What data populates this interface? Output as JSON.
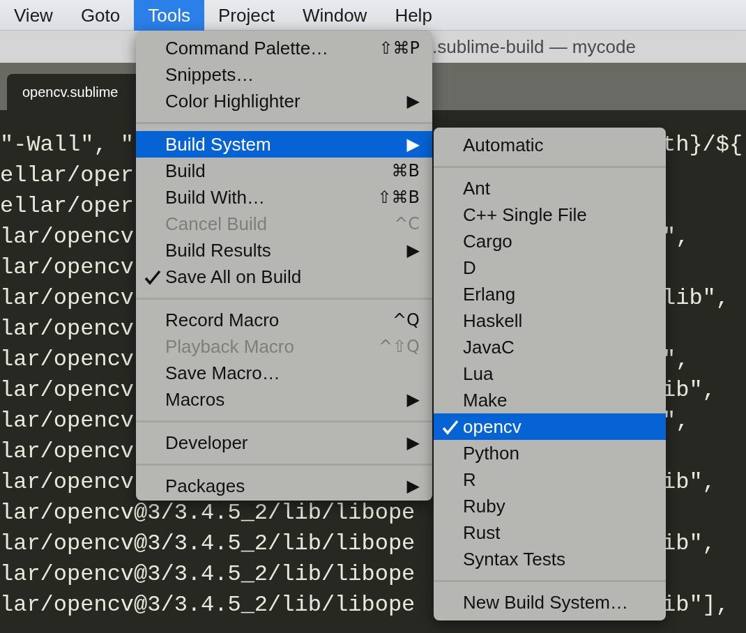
{
  "menu_bar": [
    {
      "label": "View",
      "selected": false
    },
    {
      "label": "Goto",
      "selected": false
    },
    {
      "label": "Tools",
      "selected": true
    },
    {
      "label": "Project",
      "selected": false
    },
    {
      "label": "Window",
      "selected": false
    },
    {
      "label": "Help",
      "selected": false
    }
  ],
  "window": {
    "title": ".sublime-build — mycode"
  },
  "tab": {
    "label": "opencv.sublime"
  },
  "editor_lines": [
    {
      "left": "\"-Wall\", \"",
      "right": "th}/${"
    },
    {
      "left": "ellar/oper"
    },
    {
      "left": "ellar/oper"
    },
    {
      "left": "lar/opencv",
      "right": "\","
    },
    {
      "left": "lar/opencv"
    },
    {
      "left": "lar/opencv",
      "right": "lib\","
    },
    {
      "left": "lar/opencv"
    },
    {
      "left": "lar/opencv",
      "right": "\","
    },
    {
      "left": "lar/opencv",
      "right": "ib\","
    },
    {
      "left": "lar/opencv",
      "right": "\","
    },
    {
      "left": "lar/opencv"
    },
    {
      "left": "lar/opencv",
      "right": "ib\","
    },
    {
      "left": "lar/opencv@3/3.4.5_2/lib/libope"
    },
    {
      "left": "lar/opencv@3/3.4.5_2/lib/libope",
      "right": "ib\","
    },
    {
      "left": "lar/opencv@3/3.4.5_2/lib/libope"
    },
    {
      "left": "lar/opencv@3/3.4.5_2/lib/libope",
      "right": "ib\"],"
    }
  ],
  "tools_menu": [
    {
      "kind": "item",
      "label": "Command Palette…",
      "shortcut": "⇧⌘P",
      "selected": false,
      "checked": false,
      "disabled": false
    },
    {
      "kind": "item",
      "label": "Snippets…",
      "selected": false,
      "checked": false,
      "disabled": false
    },
    {
      "kind": "item",
      "label": "Color Highlighter",
      "shortcut": "▶",
      "selected": false,
      "checked": false,
      "disabled": false
    },
    {
      "kind": "separator"
    },
    {
      "kind": "item",
      "label": "Build System",
      "shortcut": "▶",
      "selected": true,
      "checked": false,
      "disabled": false
    },
    {
      "kind": "item",
      "label": "Build",
      "shortcut": "⌘B",
      "selected": false,
      "checked": false,
      "disabled": false
    },
    {
      "kind": "item",
      "label": "Build With…",
      "shortcut": "⇧⌘B",
      "selected": false,
      "checked": false,
      "disabled": false
    },
    {
      "kind": "item",
      "label": "Cancel Build",
      "shortcut": "^C",
      "selected": false,
      "checked": false,
      "disabled": true
    },
    {
      "kind": "item",
      "label": "Build Results",
      "shortcut": "▶",
      "selected": false,
      "checked": false,
      "disabled": false
    },
    {
      "kind": "item",
      "label": "Save All on Build",
      "selected": false,
      "checked": true,
      "disabled": false
    },
    {
      "kind": "separator"
    },
    {
      "kind": "item",
      "label": "Record Macro",
      "shortcut": "^Q",
      "selected": false,
      "checked": false,
      "disabled": false
    },
    {
      "kind": "item",
      "label": "Playback Macro",
      "shortcut": "^⇧Q",
      "selected": false,
      "checked": false,
      "disabled": true
    },
    {
      "kind": "item",
      "label": "Save Macro…",
      "selected": false,
      "checked": false,
      "disabled": false
    },
    {
      "kind": "item",
      "label": "Macros",
      "shortcut": "▶",
      "selected": false,
      "checked": false,
      "disabled": false
    },
    {
      "kind": "separator"
    },
    {
      "kind": "item",
      "label": "Developer",
      "shortcut": "▶",
      "selected": false,
      "checked": false,
      "disabled": false
    },
    {
      "kind": "separator"
    },
    {
      "kind": "item",
      "label": "Packages",
      "shortcut": "▶",
      "selected": false,
      "checked": false,
      "disabled": false
    }
  ],
  "build_system_menu": [
    {
      "kind": "item",
      "label": "Automatic",
      "selected": false,
      "checked": false
    },
    {
      "kind": "separator"
    },
    {
      "kind": "item",
      "label": "Ant",
      "selected": false,
      "checked": false
    },
    {
      "kind": "item",
      "label": "C++ Single File",
      "selected": false,
      "checked": false
    },
    {
      "kind": "item",
      "label": "Cargo",
      "selected": false,
      "checked": false
    },
    {
      "kind": "item",
      "label": "D",
      "selected": false,
      "checked": false
    },
    {
      "kind": "item",
      "label": "Erlang",
      "selected": false,
      "checked": false
    },
    {
      "kind": "item",
      "label": "Haskell",
      "selected": false,
      "checked": false
    },
    {
      "kind": "item",
      "label": "JavaC",
      "selected": false,
      "checked": false
    },
    {
      "kind": "item",
      "label": "Lua",
      "selected": false,
      "checked": false
    },
    {
      "kind": "item",
      "label": "Make",
      "selected": false,
      "checked": false
    },
    {
      "kind": "item",
      "label": "opencv",
      "selected": true,
      "checked": true
    },
    {
      "kind": "item",
      "label": "Python",
      "selected": false,
      "checked": false
    },
    {
      "kind": "item",
      "label": "R",
      "selected": false,
      "checked": false
    },
    {
      "kind": "item",
      "label": "Ruby",
      "selected": false,
      "checked": false
    },
    {
      "kind": "item",
      "label": "Rust",
      "selected": false,
      "checked": false
    },
    {
      "kind": "item",
      "label": "Syntax Tests",
      "selected": false,
      "checked": false
    },
    {
      "kind": "separator"
    },
    {
      "kind": "item",
      "label": "New Build System…",
      "selected": false,
      "checked": false
    }
  ]
}
